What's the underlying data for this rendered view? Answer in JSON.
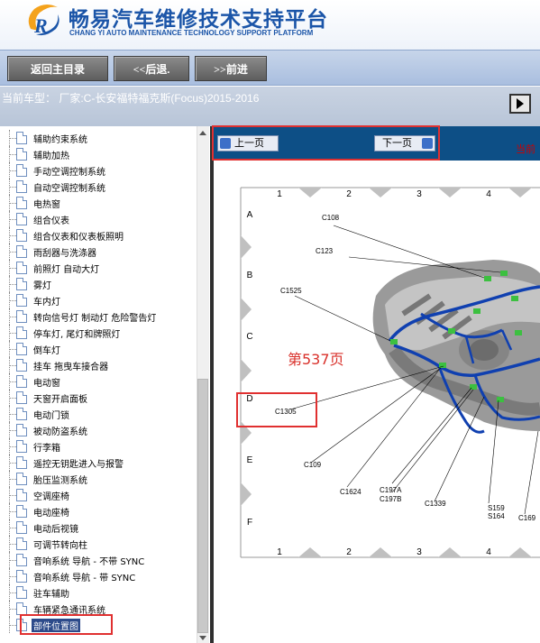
{
  "header": {
    "title_cn": "畅易汽车维修技术支持平台",
    "title_en": "CHANG YI AUTO MAINTENANCE TECHNOLOGY SUPPORT PLATFORM"
  },
  "toolbar": {
    "home_label": "返回主目录",
    "back_label": "<<后退.",
    "forward_label": ">>前进"
  },
  "vehicle": {
    "text": "当前车型：  厂家:C-长安福特福克斯(Focus)2015-2016"
  },
  "sidebar": {
    "items": [
      {
        "label": "辅助约束系统"
      },
      {
        "label": "辅助加热"
      },
      {
        "label": "手动空调控制系统"
      },
      {
        "label": "自动空调控制系统"
      },
      {
        "label": "电热窗"
      },
      {
        "label": "组合仪表"
      },
      {
        "label": "组合仪表和仪表板照明"
      },
      {
        "label": "雨刮器与洗涤器"
      },
      {
        "label": "前照灯 自动大灯"
      },
      {
        "label": "雾灯"
      },
      {
        "label": "车内灯"
      },
      {
        "label": "转向信号灯 制动灯 危险警告灯"
      },
      {
        "label": "停车灯, 尾灯和牌照灯"
      },
      {
        "label": "倒车灯"
      },
      {
        "label": "挂车 拖曳车接合器"
      },
      {
        "label": "电动窗"
      },
      {
        "label": "天窗开启面板"
      },
      {
        "label": "电动门锁"
      },
      {
        "label": "被动防盗系统"
      },
      {
        "label": "行李箱"
      },
      {
        "label": "遥控无钥匙进入与报警"
      },
      {
        "label": "胎压监测系统"
      },
      {
        "label": "空调座椅"
      },
      {
        "label": "电动座椅"
      },
      {
        "label": "电动后视镜"
      },
      {
        "label": "可调节转向柱"
      },
      {
        "label": "音响系统 导航 - 不带 SYNC"
      },
      {
        "label": "音响系统 导航 - 带 SYNC"
      },
      {
        "label": "驻车辅助"
      },
      {
        "label": "车辆紧急通讯系统"
      },
      {
        "label": "部件位置图"
      }
    ]
  },
  "nav": {
    "prev_label": "上一页",
    "next_label": "下一页",
    "current_label": "当前"
  },
  "annotation": {
    "page_label": "第537页"
  },
  "diagram": {
    "col_labels": [
      "1",
      "2",
      "3",
      "4"
    ],
    "row_labels": [
      "A",
      "B",
      "C",
      "D",
      "E",
      "F"
    ],
    "connectors": [
      "C108",
      "C123",
      "C1525",
      "C1305",
      "C109",
      "C1624",
      "C197A",
      "C197B",
      "C1339",
      "S159",
      "S164",
      "C169"
    ]
  },
  "colors": {
    "header_blue": "#1b55a8",
    "nav_blue": "#0d4f86",
    "annotation_red": "#e03030",
    "harness_blue": "#1040b0",
    "connector_green": "#3cc040"
  }
}
